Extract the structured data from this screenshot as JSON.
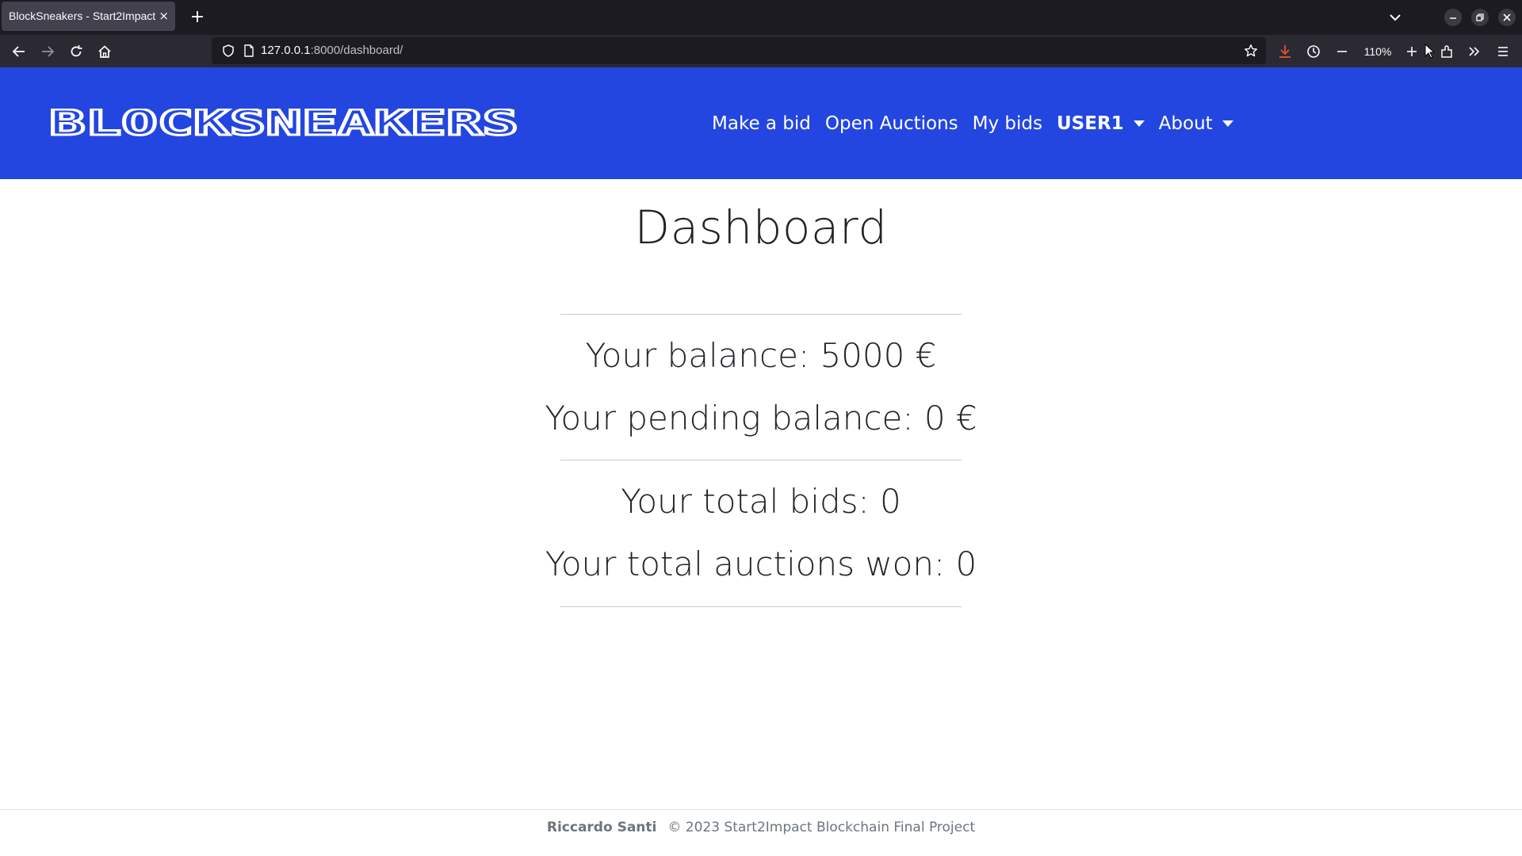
{
  "browser": {
    "tab_title": "BlockSneakers - Start2Impact",
    "tab_close": "×",
    "new_tab": "+",
    "url_host": "127.0.0.1",
    "url_path": ":8000/dashboard/",
    "zoom": "110%"
  },
  "site": {
    "brand": "BLOCKSNEAKERS",
    "nav": {
      "make_bid": "Make a bid",
      "open_auctions": "Open Auctions",
      "my_bids": "My bids",
      "user": "USER1",
      "about": "About"
    }
  },
  "dashboard": {
    "title": "Dashboard",
    "balance": "Your balance: 5000 €",
    "pending_balance": "Your pending balance: 0 €",
    "total_bids": "Your total bids: 0",
    "auctions_won": "Your total auctions won: 0"
  },
  "footer": {
    "author": "Riccardo Santi",
    "copyright": "© 2023 Start2Impact Blockchain Final Project"
  },
  "colors": {
    "header_bg": "#2346e0",
    "chrome_dark": "#1c1b22",
    "download_accent": "#e2552a"
  }
}
